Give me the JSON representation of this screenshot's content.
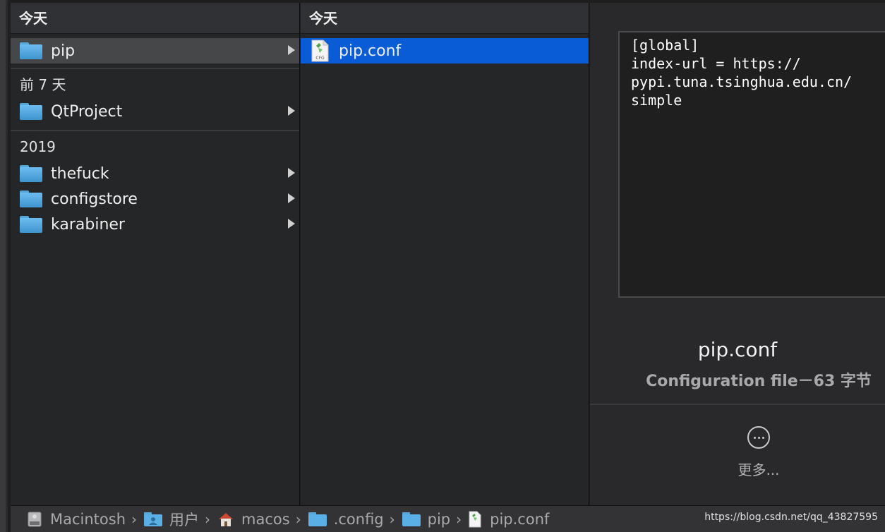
{
  "column1": {
    "groups": [
      {
        "header": "今天",
        "items": [
          {
            "name": "pip"
          }
        ]
      },
      {
        "header": "前 7 天",
        "items": [
          {
            "name": "QtProject"
          }
        ]
      },
      {
        "header": "2019",
        "items": [
          {
            "name": "thefuck"
          },
          {
            "name": "configstore"
          },
          {
            "name": "karabiner"
          }
        ]
      }
    ]
  },
  "column2": {
    "header": "今天",
    "items": [
      {
        "name": "pip.conf",
        "icon_label": "CFG"
      }
    ]
  },
  "preview": {
    "content": "[global]\nindex-url = https://\npypi.tuna.tsinghua.edu.cn/\nsimple",
    "filename": "pip.conf",
    "info": "Configuration file－63 字节",
    "more_label": "更多..."
  },
  "pathbar": {
    "crumbs": [
      "Macintosh",
      "用户",
      "macos",
      ".config",
      "pip",
      "pip.conf"
    ],
    "separator": "›"
  },
  "watermark": "https://blog.csdn.net/qq_43827595",
  "colors": {
    "selection_blue": "#0a5cd6",
    "selection_gray": "#464749",
    "folder_blue": "#58a6d8",
    "file_icon_green": "#4ca34a"
  }
}
